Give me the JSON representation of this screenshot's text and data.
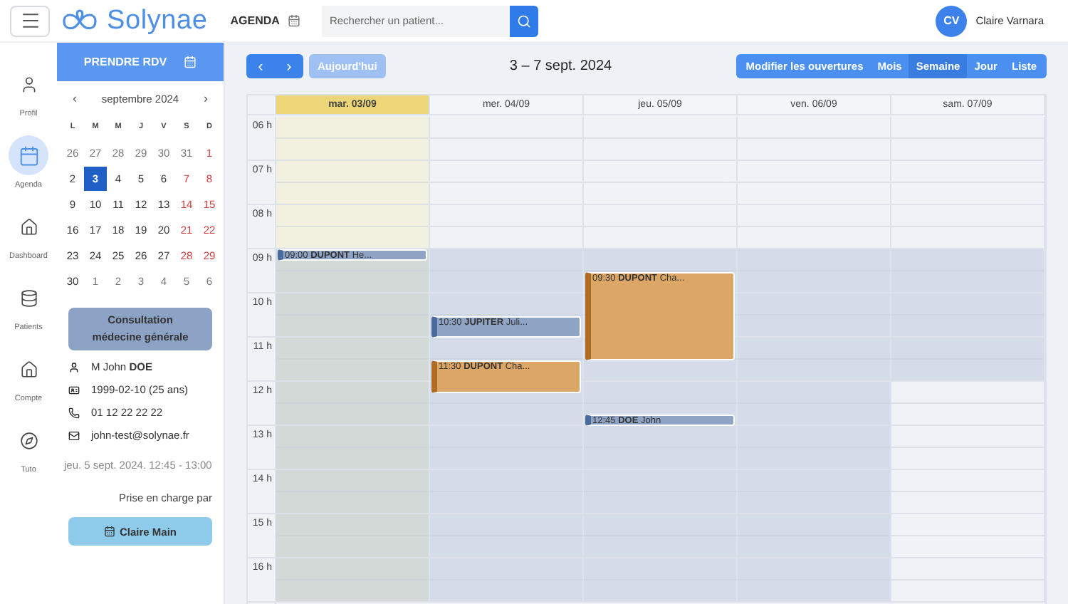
{
  "topbar": {
    "brand": "Solynae",
    "section": "AGENDA",
    "search": {
      "placeholder": "Rechercher un patient..."
    },
    "user": {
      "initials": "CV",
      "name": "Claire Varnara"
    }
  },
  "nav": [
    {
      "label": "Profil",
      "selected": false
    },
    {
      "label": "Agenda",
      "selected": true
    },
    {
      "label": "Dashboard",
      "selected": false
    },
    {
      "label": "Patients",
      "selected": false
    },
    {
      "label": "Compte",
      "selected": false
    },
    {
      "label": "Tuto",
      "selected": false
    }
  ],
  "sidebar": {
    "book_button": "PRENDRE RDV",
    "mini_calendar": {
      "prev": "‹",
      "month": "septembre 2024",
      "next": "›",
      "weekdays": [
        "L",
        "M",
        "M",
        "J",
        "V",
        "S",
        "D"
      ],
      "weeks": [
        [
          {
            "day": "26",
            "outside": true,
            "selected": false
          },
          {
            "day": "27",
            "outside": true,
            "selected": false
          },
          {
            "day": "28",
            "outside": true,
            "selected": false
          },
          {
            "day": "29",
            "outside": true,
            "selected": false
          },
          {
            "day": "30",
            "outside": true,
            "selected": false
          },
          {
            "day": "31",
            "outside": true,
            "selected": false
          },
          {
            "day": "1",
            "outside": false,
            "selected": false
          }
        ],
        [
          {
            "day": "2",
            "outside": false,
            "selected": false
          },
          {
            "day": "3",
            "outside": false,
            "selected": true
          },
          {
            "day": "4",
            "outside": false,
            "selected": false
          },
          {
            "day": "5",
            "outside": false,
            "selected": false
          },
          {
            "day": "6",
            "outside": false,
            "selected": false
          },
          {
            "day": "7",
            "outside": false,
            "selected": false
          },
          {
            "day": "8",
            "outside": false,
            "selected": false
          }
        ],
        [
          {
            "day": "9",
            "outside": false,
            "selected": false
          },
          {
            "day": "10",
            "outside": false,
            "selected": false
          },
          {
            "day": "11",
            "outside": false,
            "selected": false
          },
          {
            "day": "12",
            "outside": false,
            "selected": false
          },
          {
            "day": "13",
            "outside": false,
            "selected": false
          },
          {
            "day": "14",
            "outside": false,
            "selected": false
          },
          {
            "day": "15",
            "outside": false,
            "selected": false
          }
        ],
        [
          {
            "day": "16",
            "outside": false,
            "selected": false
          },
          {
            "day": "17",
            "outside": false,
            "selected": false
          },
          {
            "day": "18",
            "outside": false,
            "selected": false
          },
          {
            "day": "19",
            "outside": false,
            "selected": false
          },
          {
            "day": "20",
            "outside": false,
            "selected": false
          },
          {
            "day": "21",
            "outside": false,
            "selected": false
          },
          {
            "day": "22",
            "outside": false,
            "selected": false
          }
        ],
        [
          {
            "day": "23",
            "outside": false,
            "selected": false
          },
          {
            "day": "24",
            "outside": false,
            "selected": false
          },
          {
            "day": "25",
            "outside": false,
            "selected": false
          },
          {
            "day": "26",
            "outside": false,
            "selected": false
          },
          {
            "day": "27",
            "outside": false,
            "selected": false
          },
          {
            "day": "28",
            "outside": false,
            "selected": false
          },
          {
            "day": "29",
            "outside": false,
            "selected": false
          }
        ],
        [
          {
            "day": "30",
            "outside": false,
            "selected": false
          },
          {
            "day": "1",
            "outside": true,
            "selected": false
          },
          {
            "day": "2",
            "outside": true,
            "selected": false
          },
          {
            "day": "3",
            "outside": true,
            "selected": false
          },
          {
            "day": "4",
            "outside": true,
            "selected": false
          },
          {
            "day": "5",
            "outside": true,
            "selected": false
          },
          {
            "day": "6",
            "outside": true,
            "selected": false
          }
        ]
      ]
    },
    "appointment": {
      "type": "Consultation médecine générale",
      "details": [
        {
          "kind": "person",
          "text": "M John **DOE**"
        },
        {
          "kind": "birthdate",
          "text": "1999-02-10 (25 ans)"
        },
        {
          "kind": "phone",
          "text": "01 12 22 22 22"
        },
        {
          "kind": "email",
          "text": "john-test@solynae.fr"
        }
      ],
      "when": "jeu. 5 sept. 2024. 12:45 - 13:00",
      "handled_by_label": "Prise en charge par",
      "practitioner": "Claire Main"
    }
  },
  "toolbar": {
    "prev": "‹",
    "next": "›",
    "today": {
      "label": "Aujourd'hui",
      "disabled": true
    },
    "title": "3 – 7 sept. 2024",
    "views": [
      {
        "label": "Modifier les ouvertures",
        "selected": false
      },
      {
        "label": "Mois",
        "selected": false
      },
      {
        "label": "Semaine",
        "selected": true
      },
      {
        "label": "Jour",
        "selected": false
      },
      {
        "label": "Liste",
        "selected": false
      }
    ]
  },
  "calendar": {
    "hours": [
      "06 h",
      "07 h",
      "08 h",
      "09 h",
      "10 h",
      "11 h",
      "12 h",
      "13 h",
      "14 h",
      "15 h",
      "16 h"
    ],
    "days": [
      {
        "label": "mar. 03/09",
        "today": true,
        "events": [
          {
            "time": "09:00",
            "text": "**DUPONT** He...",
            "color": "#8fa4c5"
          }
        ]
      },
      {
        "label": "mer. 04/09",
        "today": false,
        "events": [
          {
            "time": "10:30",
            "text": "**JUPITER** Juli...",
            "color": "#8fa4c5"
          },
          {
            "time": "11:30",
            "text": "**DUPONT** Cha...",
            "color": "#dca666"
          }
        ]
      },
      {
        "label": "jeu. 05/09",
        "today": false,
        "events": [
          {
            "time": "09:30",
            "text": "**DUPONT** Cha...",
            "color": "#dca666"
          },
          {
            "time": "12:45",
            "text": "**DOE** John",
            "color": "#8fa4c5"
          }
        ]
      },
      {
        "label": "ven. 06/09",
        "today": false
      },
      {
        "label": "sam. 07/09",
        "today": false
      }
    ]
  }
}
